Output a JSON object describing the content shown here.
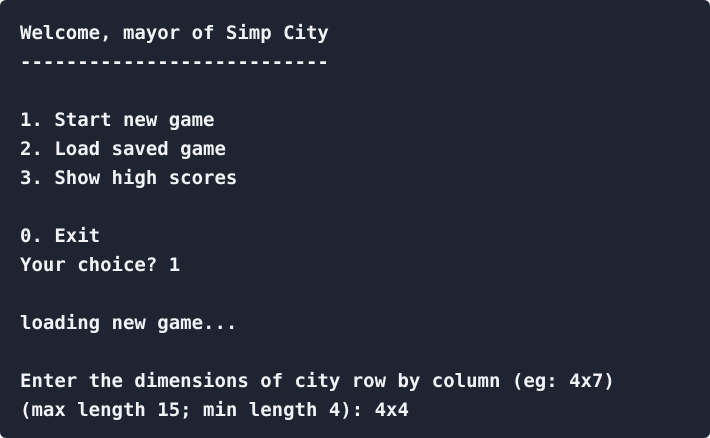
{
  "terminal": {
    "lines": [
      "Welcome, mayor of Simp City",
      "---------------------------",
      "",
      "1. Start new game",
      "2. Load saved game",
      "3. Show high scores",
      "",
      "0. Exit",
      "Your choice? 1",
      "",
      "loading new game...",
      "",
      "Enter the dimensions of city row by column (eg: 4x7)",
      "(max length 15; min length 4): 4x4"
    ]
  },
  "colors": {
    "background": "#1f2433",
    "text": "#f1f3f6"
  }
}
